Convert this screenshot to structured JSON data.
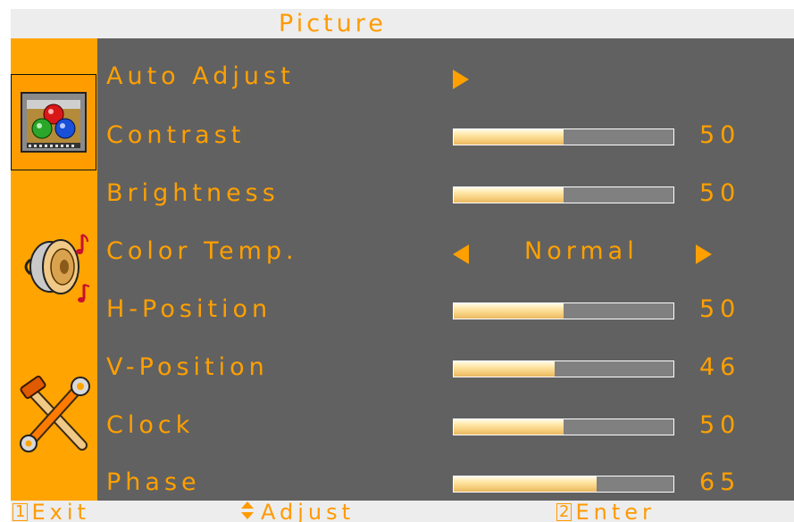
{
  "title": "Picture",
  "sidebar": {
    "icons": [
      "picture-icon",
      "audio-speaker-icon",
      "tools-icon"
    ]
  },
  "menu": {
    "auto_adjust": {
      "label": "Auto Adjust"
    },
    "contrast": {
      "label": "Contrast",
      "value": "50",
      "level": 50
    },
    "brightness": {
      "label": "Brightness",
      "value": "50",
      "level": 50
    },
    "color_temp": {
      "label": "Color Temp.",
      "option": "Normal"
    },
    "h_position": {
      "label": "H-Position",
      "value": "50",
      "level": 50
    },
    "v_position": {
      "label": "V-Position",
      "value": "46",
      "level": 46
    },
    "clock": {
      "label": "Clock",
      "value": "50",
      "level": 50
    },
    "phase": {
      "label": "Phase",
      "value": "65",
      "level": 65
    }
  },
  "footer": {
    "exit": {
      "key": "1",
      "label": "Exit"
    },
    "adjust": {
      "label": "Adjust"
    },
    "enter": {
      "key": "2",
      "label": "Enter"
    }
  },
  "colors": {
    "accent": "#ffa000",
    "panel": "#616161",
    "sidebar": "#ffa400",
    "titlebar": "#ededed"
  }
}
